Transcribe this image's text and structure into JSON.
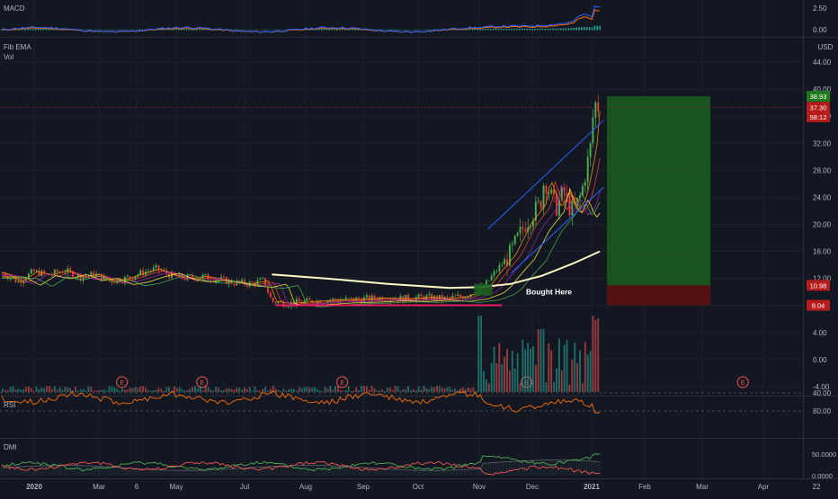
{
  "colors": {
    "background": "#131722",
    "grid": "#1e222d",
    "axis_text": "#b2b5be",
    "up": "#26a69a",
    "down": "#ef5350",
    "candle_up": "#4caf50",
    "candle_down": "#e53935",
    "macd_line": "#2962ff",
    "macd_signal": "#ff6d00",
    "hist_pos": "#26a69a",
    "hist_neg": "#ef5350",
    "rsi": "#ff6d00",
    "rsi_band": "#2a1b3d",
    "dmi_plus": "#4caf50",
    "dmi_minus": "#ef5350",
    "adx": "#5d606b",
    "channel": "#2962ff",
    "ema_long": "#fff9c4",
    "support": "#e91e63",
    "target_zone": "#1b5e20",
    "stop_zone": "#5d0f0f",
    "price_tag_green": "#1f7a1f",
    "price_tag_red": "#b71c1c"
  },
  "panes": {
    "macd": {
      "label": "MACD",
      "ticks": [
        "2.50",
        "0.00"
      ]
    },
    "price": {
      "labels": [
        "Fib EMA",
        "Vol"
      ],
      "currency": "USD",
      "ticks": [
        "44.00",
        "40.00",
        "36.00",
        "32.00",
        "28.00",
        "24.00",
        "20.00",
        "16.00",
        "12.00",
        "8.00",
        "4.00",
        "0.00",
        "-4.00"
      ],
      "tags": [
        {
          "text": "38.93",
          "color": "price_tag_green",
          "value": 38.93
        },
        {
          "text": "37.30",
          "color": "price_tag_red",
          "value": 37.3
        },
        {
          "text": "58:12",
          "color": "price_tag_red",
          "value": 35.9
        },
        {
          "text": "10.98",
          "color": "price_tag_red",
          "value": 10.98
        },
        {
          "text": "8.04",
          "color": "price_tag_red",
          "value": 8.04
        }
      ],
      "annotation": "Bought Here",
      "earnings_marker": "E",
      "earnings_dates_index": [
        0.15,
        0.25,
        0.425,
        0.655,
        0.925
      ]
    },
    "rsi": {
      "label": "RSI",
      "ticks": [
        "80.00",
        "40.00"
      ]
    },
    "dmi": {
      "label": "DMI",
      "ticks": [
        "50.0000",
        "0.0000"
      ]
    }
  },
  "time_axis": [
    "2020",
    "Mar",
    "6",
    "May",
    "Jul",
    "Aug",
    "Sep",
    "Oct",
    "Nov",
    "Dec",
    "2021",
    "Feb",
    "Mar",
    "Apr",
    "22"
  ],
  "chart_data": {
    "type": "line",
    "series": [
      {
        "values": [
          [
            0,
            12.8
          ],
          [
            0.02,
            11.5
          ],
          [
            0.04,
            13.0
          ],
          [
            0.06,
            12.5
          ],
          [
            0.08,
            13.2
          ],
          [
            0.1,
            12.2
          ],
          [
            0.12,
            12.6
          ],
          [
            0.14,
            11.6
          ],
          [
            0.16,
            12.0
          ],
          [
            0.18,
            12.8
          ],
          [
            0.2,
            13.4
          ],
          [
            0.22,
            12.4
          ],
          [
            0.24,
            12.0
          ],
          [
            0.26,
            12.3
          ],
          [
            0.28,
            11.9
          ],
          [
            0.3,
            11.4
          ],
          [
            0.32,
            11.2
          ],
          [
            0.34,
            11.7
          ],
          [
            0.35,
            8.6
          ],
          [
            0.37,
            8.3
          ],
          [
            0.4,
            8.6
          ],
          [
            0.43,
            8.8
          ],
          [
            0.46,
            8.9
          ],
          [
            0.49,
            9.1
          ],
          [
            0.52,
            9.0
          ],
          [
            0.55,
            9.2
          ],
          [
            0.575,
            9.0
          ],
          [
            0.6,
            9.4
          ],
          [
            0.62,
            10.3
          ],
          [
            0.63,
            11.3
          ],
          [
            0.64,
            12.8
          ],
          [
            0.65,
            14.2
          ],
          [
            0.66,
            15.5
          ],
          [
            0.67,
            17.8
          ],
          [
            0.68,
            20.1
          ],
          [
            0.69,
            21.6
          ],
          [
            0.7,
            23.1
          ],
          [
            0.705,
            26.8
          ],
          [
            0.71,
            25.2
          ],
          [
            0.72,
            22.4
          ],
          [
            0.73,
            24.8
          ],
          [
            0.74,
            21.9
          ],
          [
            0.75,
            23.5
          ],
          [
            0.755,
            25.6
          ],
          [
            0.76,
            28.4
          ],
          [
            0.765,
            31.5
          ],
          [
            0.77,
            38.1
          ],
          [
            0.775,
            37.3
          ]
        ]
      }
    ],
    "xlim": [
      0,
      1
    ],
    "ylim": [
      -4,
      46
    ]
  }
}
